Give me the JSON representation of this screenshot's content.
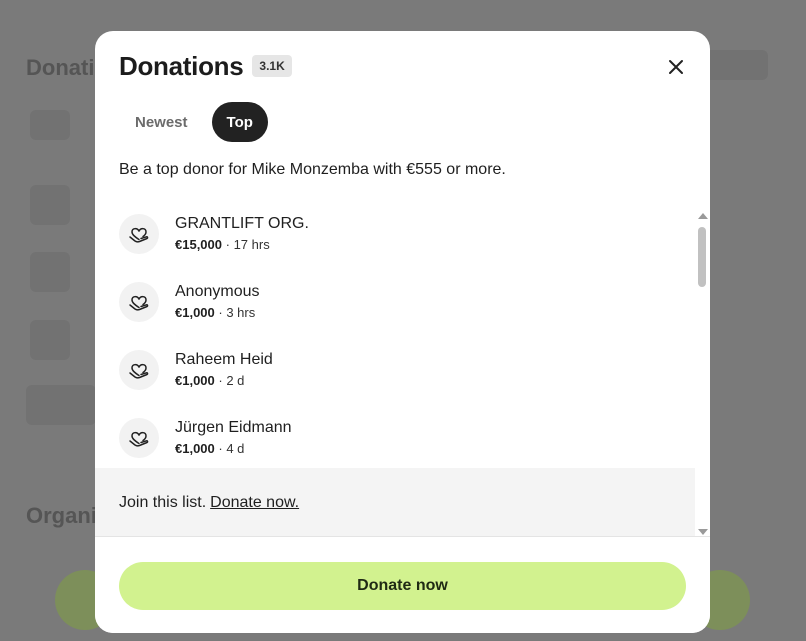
{
  "background": {
    "heading_top": "Donati",
    "heading_bottom": "Organi"
  },
  "modal": {
    "title": "Donations",
    "count_badge": "3.1K",
    "tabs": [
      {
        "label": "Newest",
        "active": false
      },
      {
        "label": "Top",
        "active": true
      }
    ],
    "intro": "Be a top donor for Mike Monzemba with €555 or more.",
    "donors": [
      {
        "name": "GRANTLIFT ORG.",
        "amount": "€15,000",
        "time": "17 hrs"
      },
      {
        "name": "Anonymous",
        "amount": "€1,000",
        "time": "3 hrs"
      },
      {
        "name": "Raheem Heid",
        "amount": "€1,000",
        "time": "2 d"
      },
      {
        "name": "Jürgen Eidmann",
        "amount": "€1,000",
        "time": "4 d"
      }
    ],
    "separator": " · ",
    "join": {
      "text": "Join this list.",
      "link": "Donate now."
    },
    "donate_button": "Donate now"
  },
  "colors": {
    "accent": "#d2f28f",
    "active_tab": "#222222",
    "overlay": "#7a7a7a"
  }
}
